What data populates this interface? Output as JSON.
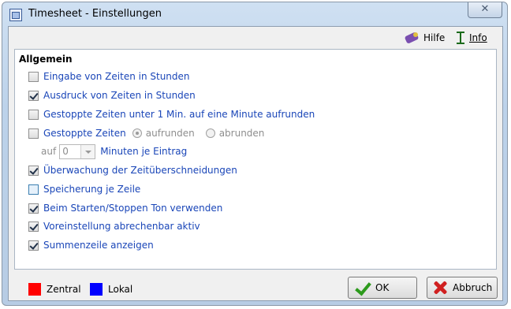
{
  "window": {
    "title": "Timesheet - Einstellungen",
    "close_glyph": "✕"
  },
  "toolbar": {
    "help_label": "Hilfe",
    "info_label": "Info"
  },
  "section": {
    "title": "Allgemein"
  },
  "options": [
    {
      "label": "Eingabe von Zeiten in Stunden",
      "checked": false
    },
    {
      "label": "Ausdruck von Zeiten in Stunden",
      "checked": true
    },
    {
      "label": "Gestoppte Zeiten unter 1 Min. auf eine Minute aufrunden",
      "checked": false
    },
    {
      "label": "Gestoppte Zeiten",
      "checked": false
    }
  ],
  "rounding": {
    "option_up": "aufrunden",
    "option_down": "abrunden",
    "selected": "aufrunden"
  },
  "entry": {
    "prefix": "auf",
    "value": "0",
    "suffix": "Minuten je Eintrag"
  },
  "options2": [
    {
      "label": "Überwachung der Zeitüberschneidungen",
      "checked": true
    },
    {
      "label": "Speicherung je Zeile",
      "checked": false
    },
    {
      "label": "Beim Starten/Stoppen Ton verwenden",
      "checked": true
    },
    {
      "label": "Voreinstellung abrechenbar aktiv",
      "checked": true
    },
    {
      "label": "Summenzeile anzeigen",
      "checked": true
    }
  ],
  "legend": {
    "central_label": "Zentral",
    "central_color": "#ff0000",
    "local_label": "Lokal",
    "local_color": "#0000ff"
  },
  "buttons": {
    "ok_label": "OK",
    "cancel_label": "Abbruch"
  }
}
